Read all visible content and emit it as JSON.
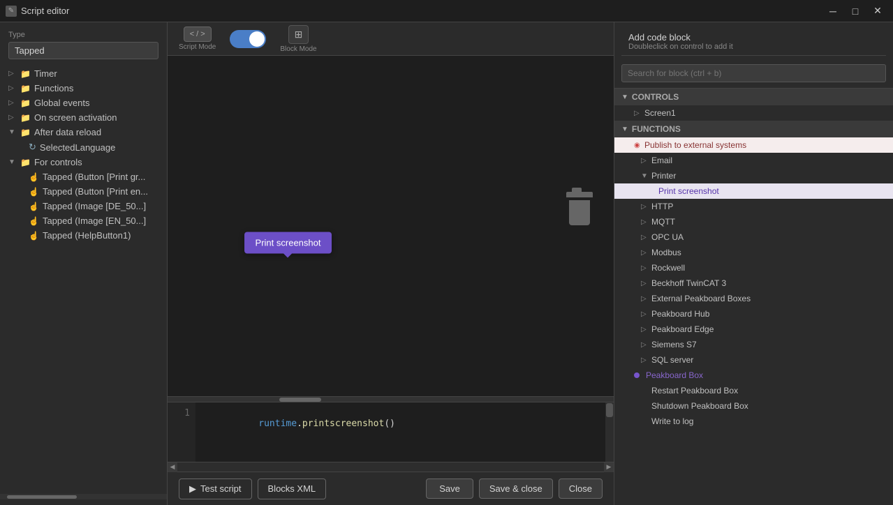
{
  "window": {
    "title": "Script editor",
    "minimize_label": "─",
    "maximize_label": "□",
    "close_label": "✕"
  },
  "type_section": {
    "label": "Type",
    "value": "Tapped"
  },
  "left_tree": {
    "items": [
      {
        "id": "timer",
        "label": "Timer",
        "indent": 0,
        "type": "folder",
        "arrow": ""
      },
      {
        "id": "functions",
        "label": "Functions",
        "indent": 0,
        "type": "folder",
        "arrow": ""
      },
      {
        "id": "global-events",
        "label": "Global events",
        "indent": 0,
        "type": "folder",
        "arrow": ""
      },
      {
        "id": "on-screen-activation",
        "label": "On screen activation",
        "indent": 0,
        "type": "folder",
        "arrow": ""
      },
      {
        "id": "after-data-reload",
        "label": "After data reload",
        "indent": 0,
        "type": "folder",
        "arrow": "▼"
      },
      {
        "id": "selected-language",
        "label": "SelectedLanguage",
        "indent": 1,
        "type": "cycle",
        "arrow": ""
      },
      {
        "id": "for-controls",
        "label": "For controls",
        "indent": 0,
        "type": "folder",
        "arrow": "▼"
      },
      {
        "id": "tapped-btn-print-gr",
        "label": "Tapped (Button [Print gr...",
        "indent": 1,
        "type": "tap",
        "arrow": ""
      },
      {
        "id": "tapped-btn-print-en",
        "label": "Tapped (Button [Print en...",
        "indent": 1,
        "type": "tap",
        "arrow": ""
      },
      {
        "id": "tapped-img-de",
        "label": "Tapped (Image [DE_50...]",
        "indent": 1,
        "type": "tap",
        "arrow": ""
      },
      {
        "id": "tapped-img-en",
        "label": "Tapped (Image [EN_50...]",
        "indent": 1,
        "type": "tap",
        "arrow": ""
      },
      {
        "id": "tapped-helpbutton",
        "label": "Tapped (HelpButton1)",
        "indent": 1,
        "type": "tap",
        "arrow": ""
      }
    ]
  },
  "toolbar": {
    "script_mode_label": "Script Mode",
    "block_mode_label": "Block Mode",
    "script_icon": "</>",
    "block_icon": "⊞"
  },
  "canvas": {
    "tooltip_text": "Print screenshot"
  },
  "code_editor": {
    "line_number": "1",
    "code_line": "runtime.printscreenshot()"
  },
  "bottom_bar": {
    "test_script_label": "Test script",
    "blocks_xml_label": "Blocks XML",
    "save_label": "Save",
    "save_close_label": "Save & close",
    "close_label": "Close"
  },
  "right_panel": {
    "add_code_block_title": "Add code block",
    "add_code_block_subtitle": "Doubleclick on control to add it",
    "search_placeholder": "Search for block (ctrl + b)",
    "sections": [
      {
        "id": "controls",
        "label": "CONTROLS",
        "expanded": true,
        "items": [
          {
            "id": "screen1",
            "label": "Screen1",
            "indent": 1,
            "selected": false
          }
        ]
      },
      {
        "id": "functions",
        "label": "FUNCTIONS",
        "expanded": true,
        "items": [
          {
            "id": "publish-external",
            "label": "Publish to external systems",
            "indent": 1,
            "active": true
          },
          {
            "id": "email",
            "label": "Email",
            "indent": 2
          },
          {
            "id": "printer",
            "label": "Printer",
            "indent": 2,
            "expanded": true
          },
          {
            "id": "print-screenshot",
            "label": "Print screenshot",
            "indent": 3,
            "highlighted": true
          },
          {
            "id": "http",
            "label": "HTTP",
            "indent": 2
          },
          {
            "id": "mqtt",
            "label": "MQTT",
            "indent": 2
          },
          {
            "id": "opc-ua",
            "label": "OPC UA",
            "indent": 2
          },
          {
            "id": "modbus",
            "label": "Modbus",
            "indent": 2
          },
          {
            "id": "rockwell",
            "label": "Rockwell",
            "indent": 2
          },
          {
            "id": "beckhoff-twincat3",
            "label": "Beckhoff TwinCAT 3",
            "indent": 2
          },
          {
            "id": "external-peakboard-boxes",
            "label": "External Peakboard Boxes",
            "indent": 2
          },
          {
            "id": "peakboard-hub",
            "label": "Peakboard Hub",
            "indent": 2
          },
          {
            "id": "peakboard-edge",
            "label": "Peakboard Edge",
            "indent": 2
          },
          {
            "id": "siemens-s7",
            "label": "Siemens S7",
            "indent": 2
          },
          {
            "id": "sql-server",
            "label": "SQL server",
            "indent": 2
          },
          {
            "id": "peakboard-box",
            "label": "Peakboard Box",
            "indent": 1,
            "peakboard_selected": true
          },
          {
            "id": "restart-peakboard-box",
            "label": "Restart Peakboard Box",
            "indent": 2
          },
          {
            "id": "shutdown-peakboard-box",
            "label": "Shutdown Peakboard Box",
            "indent": 2
          },
          {
            "id": "write-to-log",
            "label": "Write to log",
            "indent": 2
          }
        ]
      }
    ]
  }
}
